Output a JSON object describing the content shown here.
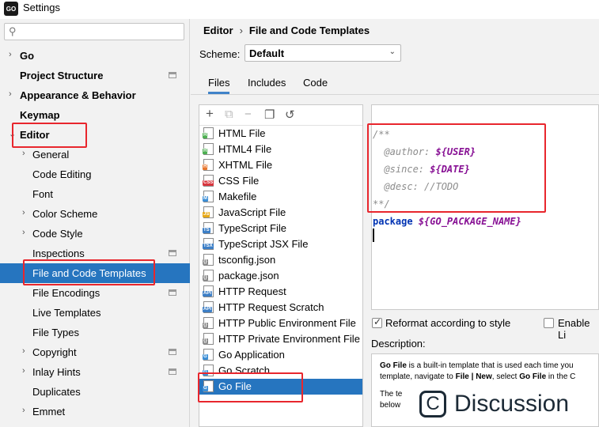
{
  "window": {
    "title": "Settings",
    "app_icon_text": "GO"
  },
  "search": {
    "value": ""
  },
  "sidebar": {
    "items": [
      {
        "label": "Go",
        "bold": true,
        "arrow": "›"
      },
      {
        "label": "Project Structure",
        "bold": true
      },
      {
        "label": "Appearance & Behavior",
        "bold": true,
        "arrow": "›"
      },
      {
        "label": "Keymap",
        "bold": true
      },
      {
        "label": "Editor",
        "bold": true,
        "arrow": "⌄"
      },
      {
        "label": "General",
        "arrow": "›"
      },
      {
        "label": "Code Editing"
      },
      {
        "label": "Font"
      },
      {
        "label": "Color Scheme",
        "arrow": "›"
      },
      {
        "label": "Code Style",
        "arrow": "›"
      },
      {
        "label": "Inspections"
      },
      {
        "label": "File and Code Templates",
        "selected": true
      },
      {
        "label": "File Encodings"
      },
      {
        "label": "Live Templates"
      },
      {
        "label": "File Types"
      },
      {
        "label": "Copyright",
        "arrow": "›"
      },
      {
        "label": "Inlay Hints",
        "arrow": "›"
      },
      {
        "label": "Duplicates"
      },
      {
        "label": "Emmet",
        "arrow": "›"
      }
    ]
  },
  "breadcrumb": {
    "parent": "Editor",
    "sep": "›",
    "current": "File and Code Templates"
  },
  "scheme": {
    "label": "Scheme:",
    "value": "Default"
  },
  "tabs": [
    {
      "label": "Files",
      "active": true
    },
    {
      "label": "Includes"
    },
    {
      "label": "Code"
    }
  ],
  "toolbar": {
    "add": "+",
    "copy": "⧉",
    "remove": "−",
    "duplicate": "❐",
    "reset": "↺"
  },
  "files": [
    {
      "label": "HTML File",
      "icon_badge": "H",
      "badge_color": "#4caf50"
    },
    {
      "label": "HTML4 File",
      "icon_badge": "H",
      "badge_color": "#4caf50"
    },
    {
      "label": "XHTML File",
      "icon_badge": "H",
      "badge_color": "#e8762d"
    },
    {
      "label": "CSS File",
      "icon_badge": "CSS",
      "badge_color": "#d9363e"
    },
    {
      "label": "Makefile",
      "icon_badge": "M",
      "badge_color": "#3d8fd6"
    },
    {
      "label": "JavaScript File",
      "icon_badge": "JS",
      "badge_color": "#e6a817"
    },
    {
      "label": "TypeScript File",
      "icon_badge": "TS",
      "badge_color": "#3d7fc6"
    },
    {
      "label": "TypeScript JSX File",
      "icon_badge": "TSX",
      "badge_color": "#3d7fc6"
    },
    {
      "label": "tsconfig.json",
      "icon_badge": "{}",
      "badge_color": "#8a8a8a"
    },
    {
      "label": "package.json",
      "icon_badge": "{}",
      "badge_color": "#8a8a8a"
    },
    {
      "label": "HTTP Request",
      "icon_badge": "API",
      "badge_color": "#3d7fc6"
    },
    {
      "label": "HTTP Request Scratch",
      "icon_badge": "API",
      "badge_color": "#3d7fc6"
    },
    {
      "label": "HTTP Public Environment File",
      "icon_badge": "{}",
      "badge_color": "#8a8a8a"
    },
    {
      "label": "HTTP Private Environment File",
      "icon_badge": "{}",
      "badge_color": "#8a8a8a"
    },
    {
      "label": "Go Application",
      "icon_badge": "G",
      "badge_color": "#3d8fd6"
    },
    {
      "label": "Go Scratch",
      "icon_badge": "G",
      "badge_color": "#3d8fd6"
    },
    {
      "label": "Go File",
      "icon_badge": "G",
      "badge_color": "#3d8fd6",
      "selected": true
    }
  ],
  "code": {
    "line1": "/**",
    "author_tag": "  @author: ",
    "author_var": "${USER}",
    "since_tag": "  @since: ",
    "since_var": "${DATE}",
    "desc_tag": "  @desc: ",
    "desc_val": "//TODO",
    "line5": "**/",
    "pkg_kw": "package",
    "pkg_var": "${GO_PACKAGE_NAME}"
  },
  "options": {
    "reformat_label": "Reformat according to style",
    "reformat_checked": true,
    "enable_label": "Enable Li",
    "enable_checked": false
  },
  "description": {
    "label": "Description:",
    "p1_bold": "Go File",
    "p1_rest": " is a built-in template that is used each time you",
    "p2_start": "template, navigate to ",
    "p2_b1": "File | New",
    "p2_mid": ", select ",
    "p2_b2": "Go File",
    "p2_end": " in the C",
    "p3": "The te",
    "p4": "below"
  },
  "watermark": {
    "text": "Discussion",
    "logo": "C"
  },
  "colors": {
    "selection": "#2675bf",
    "highlight_box": "#e8262d"
  }
}
